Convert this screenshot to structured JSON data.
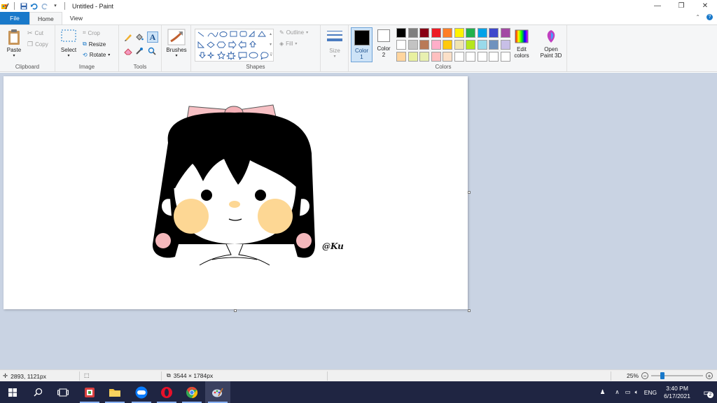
{
  "window": {
    "title": "Untitled - Paint"
  },
  "tabs": {
    "file": "File",
    "home": "Home",
    "view": "View"
  },
  "clipboard": {
    "paste": "Paste",
    "cut": "Cut",
    "copy": "Copy",
    "label": "Clipboard"
  },
  "image": {
    "select": "Select",
    "crop": "Crop",
    "resize": "Resize",
    "rotate": "Rotate",
    "label": "Image"
  },
  "tools": {
    "label": "Tools"
  },
  "brushes": {
    "label": "Brushes"
  },
  "shapes": {
    "label": "Shapes",
    "outline": "Outline",
    "fill": "Fill"
  },
  "size": {
    "label": "Size"
  },
  "colors": {
    "color1": "Color",
    "color1_num": "1",
    "color2": "Color",
    "color2_num": "2",
    "edit": "Edit",
    "edit2": "colors",
    "label": "Colors",
    "color1_value": "#000000",
    "color2_value": "#ffffff",
    "palette_row1": [
      "#000000",
      "#7f7f7f",
      "#880015",
      "#ed1c24",
      "#ff7f27",
      "#fff200",
      "#22b14c",
      "#00a2e8",
      "#3f48cc",
      "#a349a4"
    ],
    "palette_row2": [
      "#ffffff",
      "#c3c3c3",
      "#b97a57",
      "#ffaec9",
      "#ffc90e",
      "#efe4b0",
      "#b5e61d",
      "#99d9ea",
      "#7092be",
      "#c8bfe7"
    ],
    "palette_row3": [
      "#ffd59e",
      "#e8f0a0",
      "#e8f0b0",
      "#ffc0c0",
      "#fbe0c8",
      "#ffffff",
      "#ffffff",
      "#ffffff",
      "#ffffff",
      "#ffffff"
    ]
  },
  "paint3d": {
    "line1": "Open",
    "line2": "Paint 3D"
  },
  "drawing": {
    "signature": "@Ku"
  },
  "status": {
    "cursor": "2893, 1121px",
    "size": "3544 × 1784px",
    "zoom": "25%",
    "zoom_fraction": 0.25
  },
  "tray": {
    "lang": "ENG",
    "time": "3:40 PM",
    "date": "6/17/2021",
    "notif": "2"
  }
}
